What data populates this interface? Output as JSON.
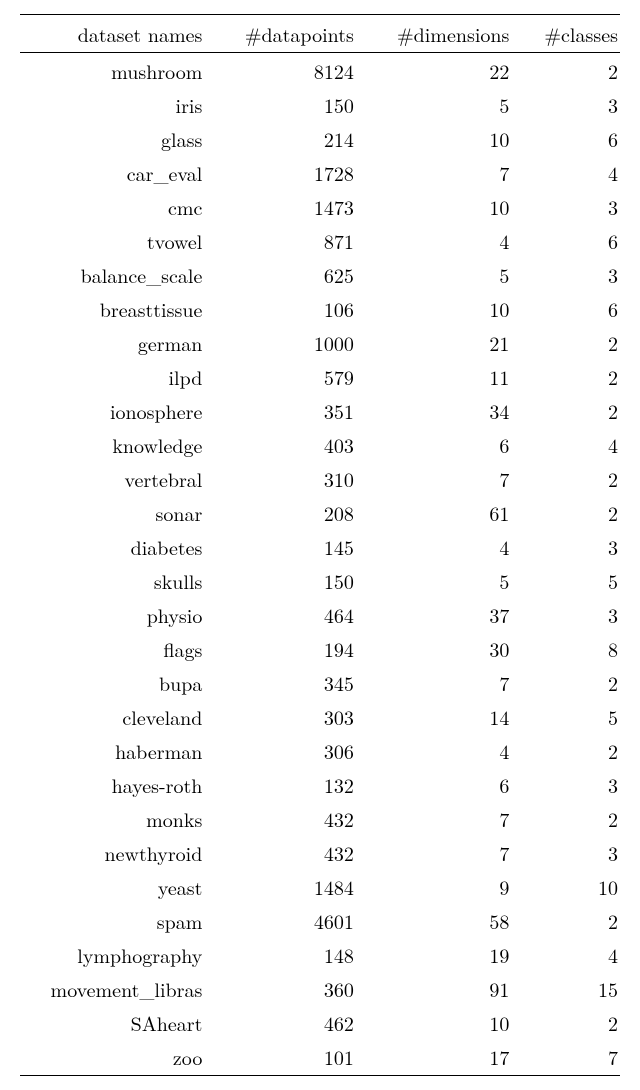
{
  "chart_data": {
    "type": "table",
    "headers": [
      "dataset names",
      "#datapoints",
      "#dimensions",
      "#classes"
    ],
    "rows": [
      {
        "name": "mushroom",
        "datapoints": 8124,
        "dimensions": 22,
        "classes": 2
      },
      {
        "name": "iris",
        "datapoints": 150,
        "dimensions": 5,
        "classes": 3
      },
      {
        "name": "glass",
        "datapoints": 214,
        "dimensions": 10,
        "classes": 6
      },
      {
        "name": "car_eval",
        "datapoints": 1728,
        "dimensions": 7,
        "classes": 4
      },
      {
        "name": "cmc",
        "datapoints": 1473,
        "dimensions": 10,
        "classes": 3
      },
      {
        "name": "tvowel",
        "datapoints": 871,
        "dimensions": 4,
        "classes": 6
      },
      {
        "name": "balance_scale",
        "datapoints": 625,
        "dimensions": 5,
        "classes": 3
      },
      {
        "name": "breasttissue",
        "datapoints": 106,
        "dimensions": 10,
        "classes": 6
      },
      {
        "name": "german",
        "datapoints": 1000,
        "dimensions": 21,
        "classes": 2
      },
      {
        "name": "ilpd",
        "datapoints": 579,
        "dimensions": 11,
        "classes": 2
      },
      {
        "name": "ionosphere",
        "datapoints": 351,
        "dimensions": 34,
        "classes": 2
      },
      {
        "name": "knowledge",
        "datapoints": 403,
        "dimensions": 6,
        "classes": 4
      },
      {
        "name": "vertebral",
        "datapoints": 310,
        "dimensions": 7,
        "classes": 2
      },
      {
        "name": "sonar",
        "datapoints": 208,
        "dimensions": 61,
        "classes": 2
      },
      {
        "name": "diabetes",
        "datapoints": 145,
        "dimensions": 4,
        "classes": 3
      },
      {
        "name": "skulls",
        "datapoints": 150,
        "dimensions": 5,
        "classes": 5
      },
      {
        "name": "physio",
        "datapoints": 464,
        "dimensions": 37,
        "classes": 3
      },
      {
        "name": "flags",
        "datapoints": 194,
        "dimensions": 30,
        "classes": 8
      },
      {
        "name": "bupa",
        "datapoints": 345,
        "dimensions": 7,
        "classes": 2
      },
      {
        "name": "cleveland",
        "datapoints": 303,
        "dimensions": 14,
        "classes": 5
      },
      {
        "name": "haberman",
        "datapoints": 306,
        "dimensions": 4,
        "classes": 2
      },
      {
        "name": "hayes-roth",
        "datapoints": 132,
        "dimensions": 6,
        "classes": 3
      },
      {
        "name": "monks",
        "datapoints": 432,
        "dimensions": 7,
        "classes": 2
      },
      {
        "name": "newthyroid",
        "datapoints": 432,
        "dimensions": 7,
        "classes": 3
      },
      {
        "name": "yeast",
        "datapoints": 1484,
        "dimensions": 9,
        "classes": 10
      },
      {
        "name": "spam",
        "datapoints": 4601,
        "dimensions": 58,
        "classes": 2
      },
      {
        "name": "lymphography",
        "datapoints": 148,
        "dimensions": 19,
        "classes": 4
      },
      {
        "name": "movement_libras",
        "datapoints": 360,
        "dimensions": 91,
        "classes": 15
      },
      {
        "name": "SAheart",
        "datapoints": 462,
        "dimensions": 10,
        "classes": 2
      },
      {
        "name": "zoo",
        "datapoints": 101,
        "dimensions": 17,
        "classes": 7
      }
    ]
  }
}
